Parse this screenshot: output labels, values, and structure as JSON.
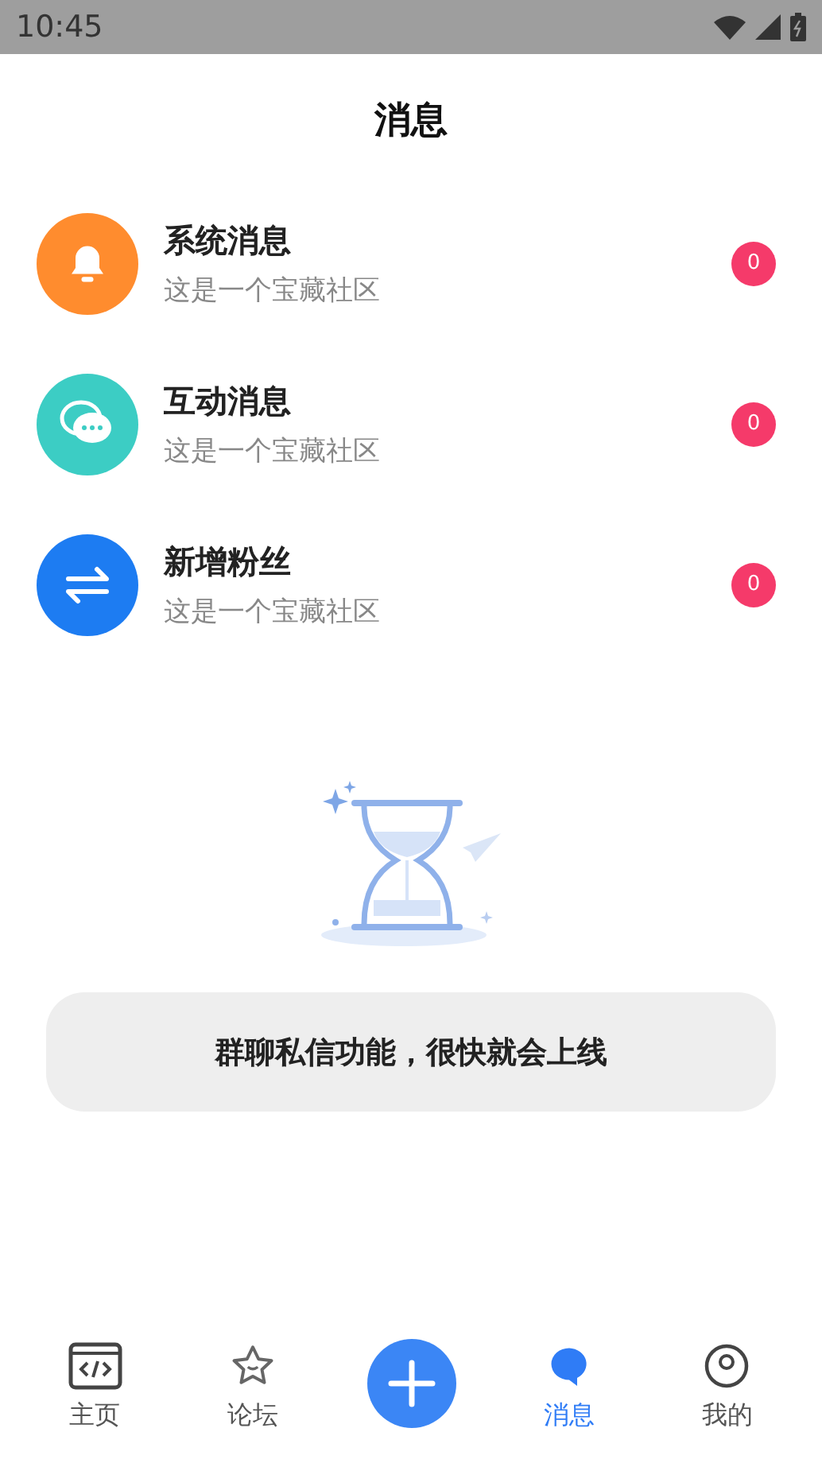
{
  "status_bar": {
    "time": "10:45"
  },
  "title": "消息",
  "messages": [
    {
      "kind": "bell",
      "title": "系统消息",
      "subtitle": "这是一个宝藏社区",
      "count": "0",
      "color": "#ff8c2e"
    },
    {
      "kind": "chat",
      "title": "互动消息",
      "subtitle": "这是一个宝藏社区",
      "count": "0",
      "color": "#3ccdc4"
    },
    {
      "kind": "swap",
      "title": "新增粉丝",
      "subtitle": "这是一个宝藏社区",
      "count": "0",
      "color": "#1d7cf2"
    }
  ],
  "notice": "群聊私信功能，很快就会上线",
  "tabs": [
    {
      "kind": "code",
      "label": "主页",
      "selected": false
    },
    {
      "kind": "star",
      "label": "论坛",
      "selected": false
    },
    {
      "kind": "add",
      "selected": false
    },
    {
      "kind": "message",
      "label": "消息",
      "selected": true
    },
    {
      "kind": "user",
      "label": "我的",
      "selected": false
    }
  ]
}
